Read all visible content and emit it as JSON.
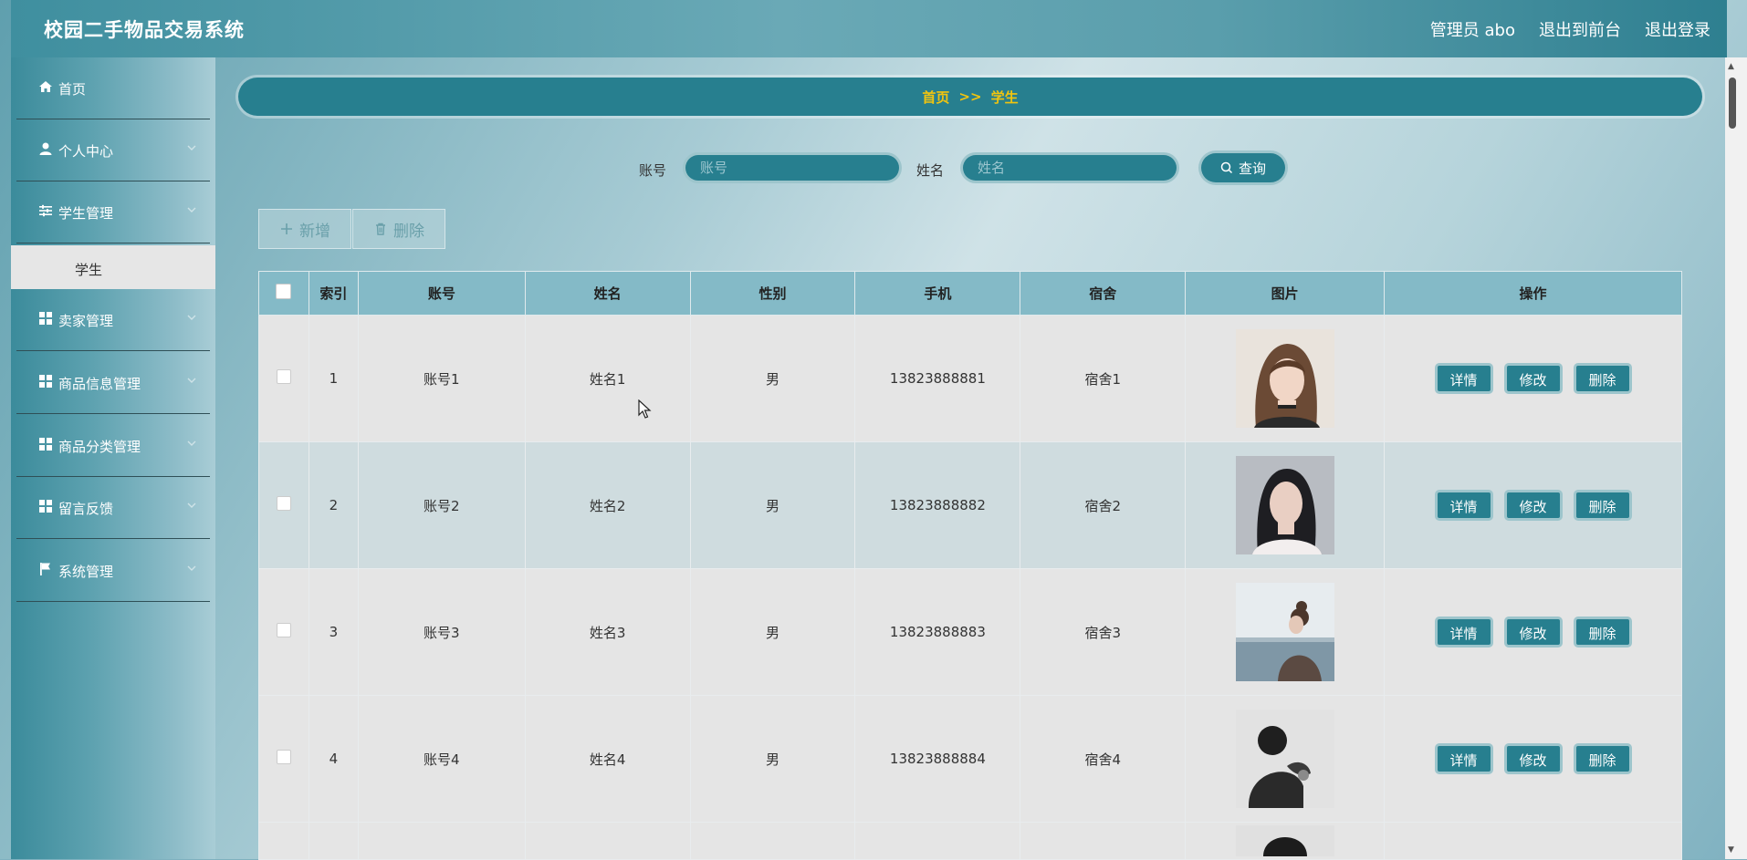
{
  "header": {
    "title": "校园二手物品交易系统",
    "user_label": "管理员 abo",
    "to_front_label": "退出到前台",
    "logout_label": "退出登录"
  },
  "sidebar": {
    "items": [
      {
        "label": "首页",
        "icon": "home-icon"
      },
      {
        "label": "个人中心",
        "icon": "user-icon"
      },
      {
        "label": "学生管理",
        "icon": "sliders-icon"
      },
      {
        "label": "卖家管理",
        "icon": "grid-icon"
      },
      {
        "label": "商品信息管理",
        "icon": "grid-icon"
      },
      {
        "label": "商品分类管理",
        "icon": "grid-icon"
      },
      {
        "label": "留言反馈",
        "icon": "grid-icon"
      },
      {
        "label": "系统管理",
        "icon": "flag-icon"
      }
    ],
    "submenu_active": "学生"
  },
  "breadcrumb": {
    "home": "首页",
    "sep": ">>",
    "current": "学生"
  },
  "search": {
    "account_label": "账号",
    "account_placeholder": "账号",
    "name_label": "姓名",
    "name_placeholder": "姓名",
    "query_label": "查询"
  },
  "actions": {
    "add_label": "新增",
    "delete_label": "删除"
  },
  "table": {
    "headers": [
      "索引",
      "账号",
      "姓名",
      "性别",
      "手机",
      "宿舍",
      "图片",
      "操作"
    ],
    "rows": [
      {
        "index": "1",
        "account": "账号1",
        "name": "姓名1",
        "gender": "男",
        "phone": "13823888881",
        "dorm": "宿舍1"
      },
      {
        "index": "2",
        "account": "账号2",
        "name": "姓名2",
        "gender": "男",
        "phone": "13823888882",
        "dorm": "宿舍2"
      },
      {
        "index": "3",
        "account": "账号3",
        "name": "姓名3",
        "gender": "男",
        "phone": "13823888883",
        "dorm": "宿舍3"
      },
      {
        "index": "4",
        "account": "账号4",
        "name": "姓名4",
        "gender": "男",
        "phone": "13823888884",
        "dorm": "宿舍4"
      }
    ],
    "row_buttons": {
      "detail": "详情",
      "edit": "修改",
      "delete": "删除"
    }
  },
  "colors": {
    "primary": "#277f8f",
    "breadcrumb_text": "#f1c40f",
    "header_row": "#84bac7"
  }
}
